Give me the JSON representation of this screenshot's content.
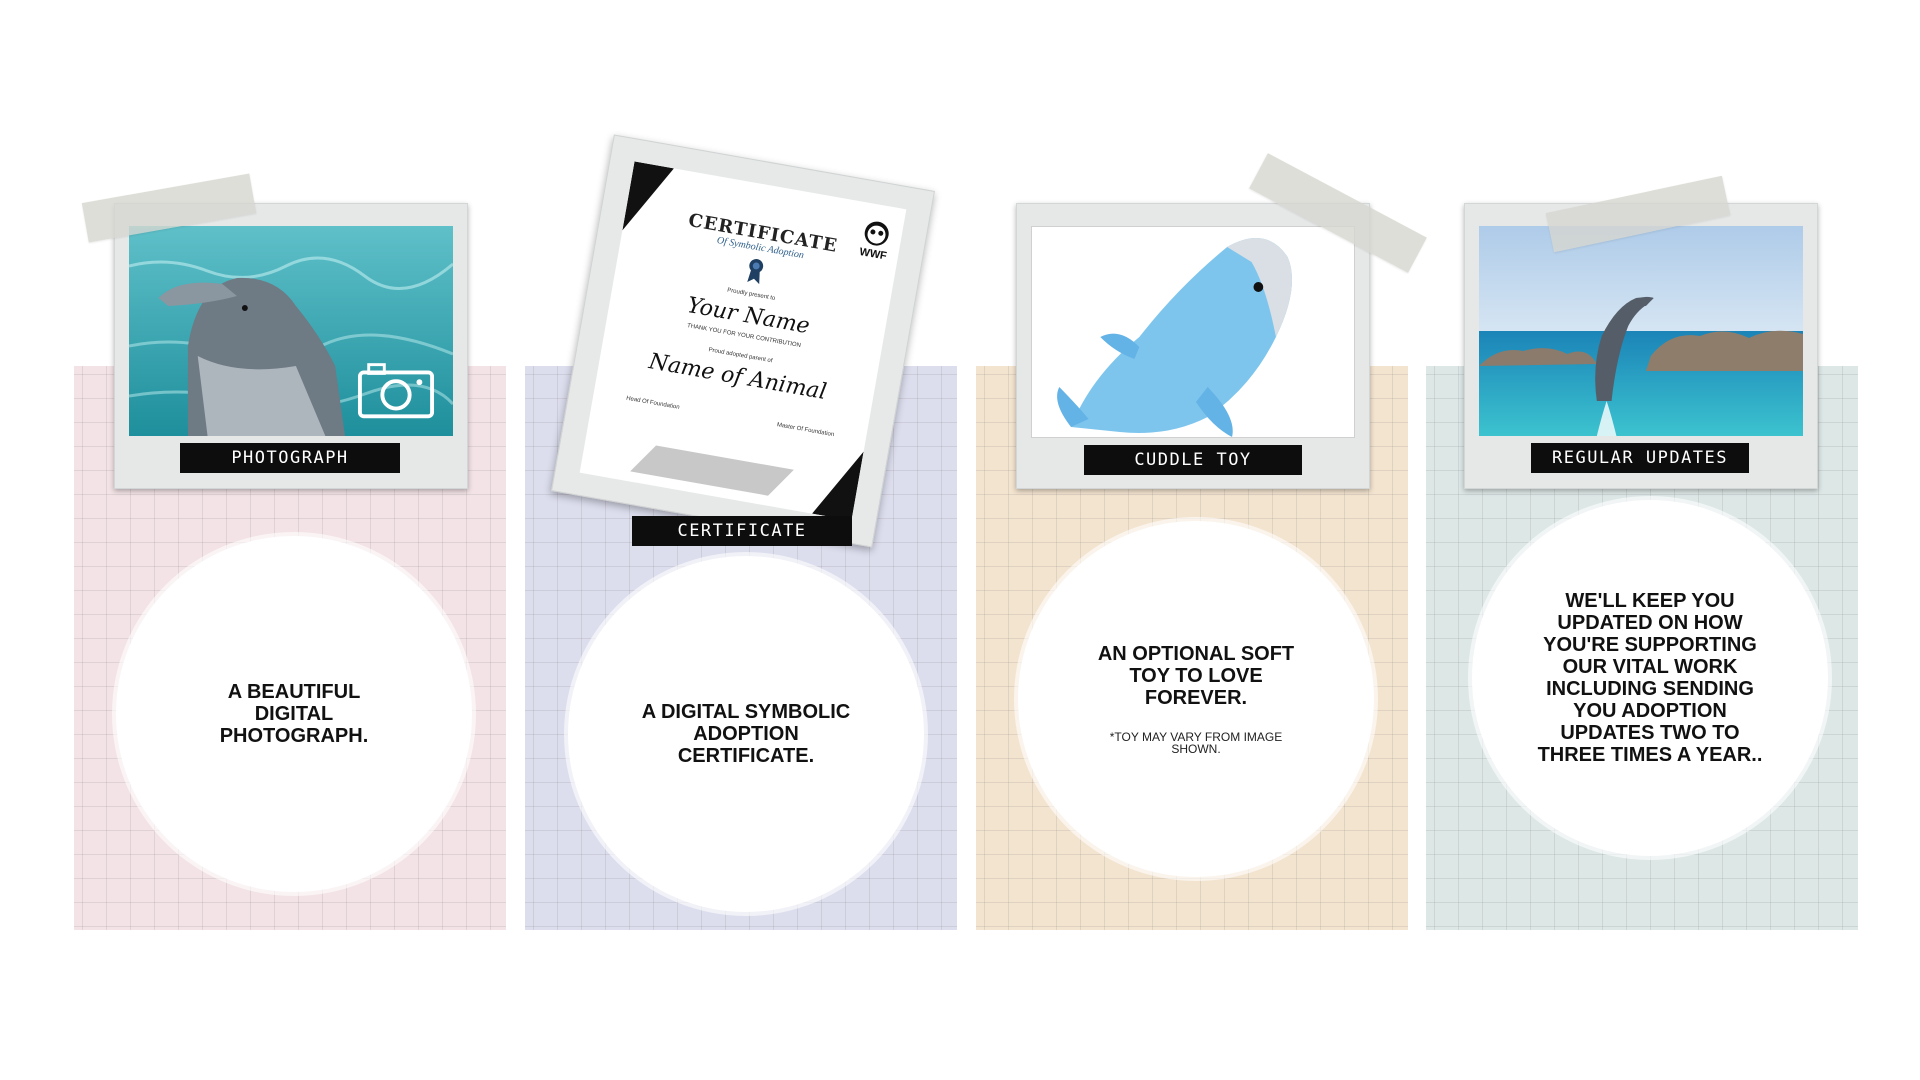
{
  "cards": [
    {
      "label": "PHOTOGRAPH",
      "text": "A BEAUTIFUL DIGITAL PHOTOGRAPH.",
      "panel_color": "#f3e3e6"
    },
    {
      "label": "CERTIFICATE",
      "text": "A DIGITAL SYMBOLIC ADOPTION CERTIFICATE.",
      "panel_color": "#dcdded"
    },
    {
      "label": "CUDDLE TOY",
      "text": "AN OPTIONAL SOFT TOY TO LOVE FOREVER.",
      "note": "*TOY MAY VARY FROM IMAGE SHOWN.",
      "panel_color": "#f3e4cf"
    },
    {
      "label": "REGULAR UPDATES",
      "text": "WE'LL KEEP YOU UPDATED ON HOW YOU'RE SUPPORTING OUR VITAL WORK INCLUDING SENDING YOU ADOPTION UPDATES TWO TO THREE TIMES A YEAR..",
      "panel_color": "#dde7e6"
    }
  ],
  "certificate": {
    "title": "CERTIFICATE",
    "subtitle": "Of Symbolic Adoption",
    "presented": "Proudly present to",
    "name": "Your Name",
    "thanks": "THANK YOU FOR YOUR CONTRIBUTION",
    "adopted": "Proud adopted parent of",
    "animal": "Name of Animal",
    "sig1": "Head Of Foundation",
    "sig2": "Master Of Foundation",
    "logo": "WWF"
  },
  "icons": {
    "camera": "camera-icon"
  }
}
